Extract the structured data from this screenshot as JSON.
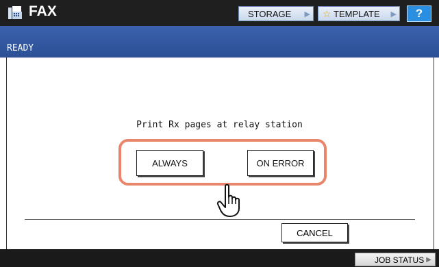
{
  "header": {
    "title": "FAX",
    "storage_label": "STORAGE",
    "template_label": "TEMPLATE",
    "help_label": "?"
  },
  "status": {
    "text": "READY"
  },
  "main": {
    "prompt": "Print Rx pages at relay station",
    "options": [
      {
        "label": "ALWAYS"
      },
      {
        "label": "ON ERROR"
      }
    ],
    "cancel_label": "CANCEL"
  },
  "footer": {
    "job_status_label": "JOB STATUS"
  },
  "icons": [
    "fax-icon",
    "star-icon",
    "chevron-right-icon",
    "pointing-hand-icon"
  ],
  "colors": {
    "title_bar": "#1f1f1f",
    "status_bar": "#3558a3",
    "help_button": "#2a8fe0",
    "highlight_frame": "#e8856a"
  }
}
